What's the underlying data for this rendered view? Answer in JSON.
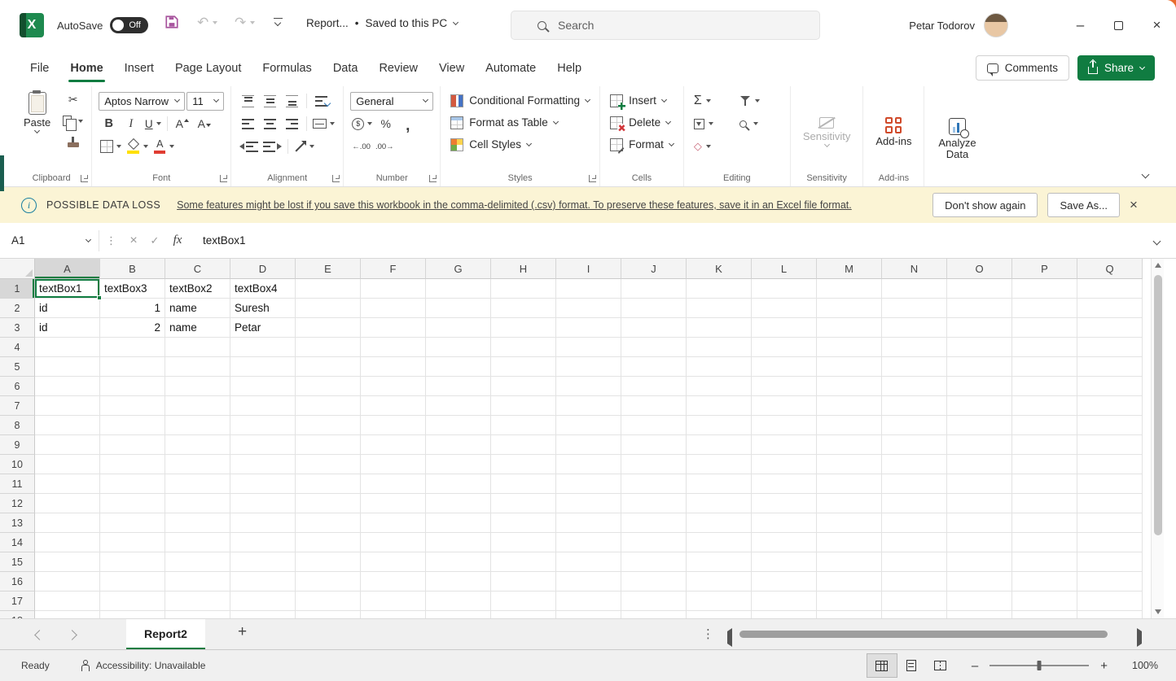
{
  "colors": {
    "excel_green": "#107C41",
    "excel_dark_green": "#134F2E",
    "warning_bar_bg": "#FBF4D5",
    "share_button_bg": "#107C41",
    "addins_icon_red": "#D04A2A",
    "fill_color_swatch": "#FFE000",
    "font_color_swatch": "#E03C32",
    "selection_border": "#107C41"
  },
  "titlebar": {
    "logo_letter": "X",
    "autosave_label": "AutoSave",
    "autosave_state": "Off",
    "doc_title": "Report...",
    "separator": "•",
    "save_status": "Saved to this PC",
    "search_placeholder": "Search",
    "user_name": "Petar Todorov"
  },
  "icons": {
    "undo": "↶",
    "redo": "↷",
    "cut": "✂",
    "minimize": "–",
    "close": "×",
    "cancel": "×",
    "enter": "✓",
    "dots_vertical": "⋮",
    "clear": "◇",
    "new_sheet": "+",
    "zoom_out": "–",
    "zoom_in": "+"
  },
  "menubar": {
    "tabs": [
      "File",
      "Home",
      "Insert",
      "Page Layout",
      "Formulas",
      "Data",
      "Review",
      "View",
      "Automate",
      "Help"
    ],
    "active_tab": "Home",
    "comments_label": "Comments",
    "share_label": "Share"
  },
  "ribbon": {
    "clipboard": {
      "label": "Clipboard",
      "paste_label": "Paste"
    },
    "font": {
      "label": "Font",
      "family": "Aptos Narrow",
      "size": "11",
      "bold": "B",
      "italic": "I",
      "underline": "U",
      "grow": "A",
      "shrink": "A",
      "color_letter": "A"
    },
    "alignment": {
      "label": "Alignment"
    },
    "number": {
      "label": "Number",
      "format": "General",
      "accounting": "$",
      "percent": "%",
      "comma": ",",
      "increase_decimal": "←.00",
      "decrease_decimal": ".00→"
    },
    "styles": {
      "label": "Styles",
      "items": [
        "Conditional Formatting",
        "Format as Table",
        "Cell Styles"
      ]
    },
    "cells": {
      "label": "Cells",
      "items": [
        "Insert",
        "Delete",
        "Format"
      ]
    },
    "editing": {
      "label": "Editing",
      "autosum": "Σ"
    },
    "sensitivity": {
      "label": "Sensitivity",
      "button": "Sensitivity"
    },
    "addins": {
      "label": "Add-ins",
      "button": "Add-ins"
    },
    "analyze": {
      "button": "Analyze Data"
    }
  },
  "warning_bar": {
    "title": "POSSIBLE DATA LOSS",
    "message": "Some features might be lost if you save this workbook in the comma-delimited (.csv) format. To preserve these features, save it in an Excel file format.",
    "dismiss_label": "Don't show again",
    "save_as_label": "Save As..."
  },
  "formula_bar": {
    "name_box": "A1",
    "fx_label": "fx",
    "content": "textBox1"
  },
  "grid": {
    "columns": [
      "A",
      "B",
      "C",
      "D",
      "E",
      "F",
      "G",
      "H",
      "I",
      "J",
      "K",
      "L",
      "M",
      "N",
      "O",
      "P",
      "Q"
    ],
    "visible_rows": 18,
    "selected_cell": {
      "row": 1,
      "col": "A"
    },
    "cells": [
      {
        "ref": "A1",
        "row": 1,
        "col": "A",
        "value": "textBox1"
      },
      {
        "ref": "B1",
        "row": 1,
        "col": "B",
        "value": "textBox3"
      },
      {
        "ref": "C1",
        "row": 1,
        "col": "C",
        "value": "textBox2"
      },
      {
        "ref": "D1",
        "row": 1,
        "col": "D",
        "value": "textBox4"
      },
      {
        "ref": "A2",
        "row": 2,
        "col": "A",
        "value": "id"
      },
      {
        "ref": "B2",
        "row": 2,
        "col": "B",
        "value": "1",
        "align": "right"
      },
      {
        "ref": "C2",
        "row": 2,
        "col": "C",
        "value": "name"
      },
      {
        "ref": "D2",
        "row": 2,
        "col": "D",
        "value": "Suresh"
      },
      {
        "ref": "A3",
        "row": 3,
        "col": "A",
        "value": "id"
      },
      {
        "ref": "B3",
        "row": 3,
        "col": "B",
        "value": "2",
        "align": "right"
      },
      {
        "ref": "C3",
        "row": 3,
        "col": "C",
        "value": "name"
      },
      {
        "ref": "D3",
        "row": 3,
        "col": "D",
        "value": "Petar"
      }
    ]
  },
  "sheet_bar": {
    "active_sheet": "Report2"
  },
  "status_bar": {
    "ready_label": "Ready",
    "accessibility_label": "Accessibility: Unavailable",
    "zoom_level": "100%"
  }
}
